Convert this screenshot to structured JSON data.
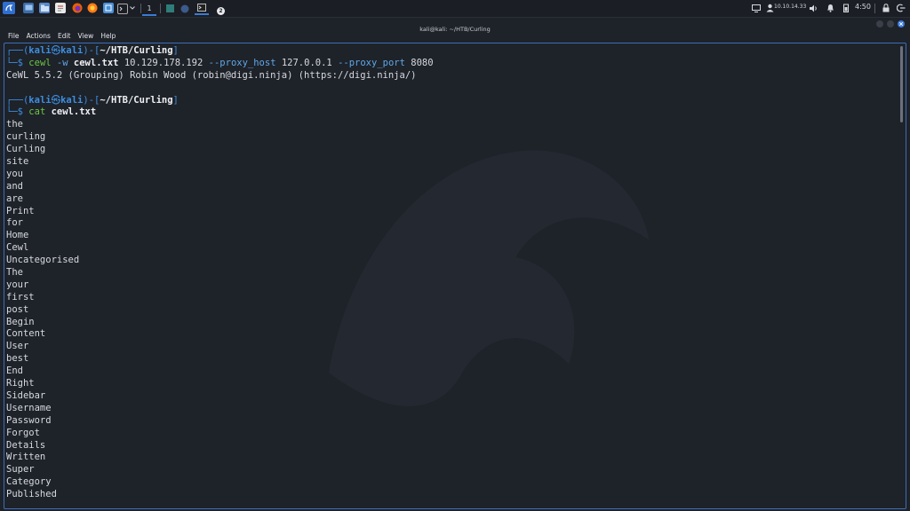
{
  "taskbar": {
    "workspace_label": "1",
    "notification_count": "2",
    "ip_address": "10.10.14.33",
    "time": "4:50"
  },
  "window": {
    "title": "kali@kali: ~/HTB/Curling"
  },
  "menu": [
    "File",
    "Actions",
    "Edit",
    "View",
    "Help"
  ],
  "terminal": {
    "prompt_user": "kali",
    "prompt_at": "㉿",
    "prompt_host": "kali",
    "prompt_dir": "~/HTB/Curling",
    "cmd1": {
      "program": "cewl",
      "opt_w": "-w",
      "outfile": "cewl.txt",
      "target": "10.129.178.192",
      "opt_host": "--proxy_host",
      "host_val": "127.0.0.1",
      "opt_port": "--proxy_port",
      "port_val": "8080"
    },
    "cmd1_output": "CeWL 5.5.2 (Grouping) Robin Wood (robin@digi.ninja) (https://digi.ninja/)",
    "cmd2": {
      "program": "cat",
      "file": "cewl.txt"
    },
    "words": [
      "the",
      "curling",
      "Curling",
      "site",
      "you",
      "and",
      "are",
      "Print",
      "for",
      "Home",
      "Cewl",
      "Uncategorised",
      "The",
      "your",
      "first",
      "post",
      "Begin",
      "Content",
      "User",
      "best",
      "End",
      "Right",
      "Sidebar",
      "Username",
      "Password",
      "Forgot",
      "Details",
      "Written",
      "Super",
      "Category",
      "Published"
    ]
  },
  "colors": {
    "prompt_frame": "#3d8fe0",
    "prompt_user": "#3d8fe0",
    "command": "#6cc644",
    "background": "#1e2229",
    "window_border": "#3c6fb8"
  }
}
